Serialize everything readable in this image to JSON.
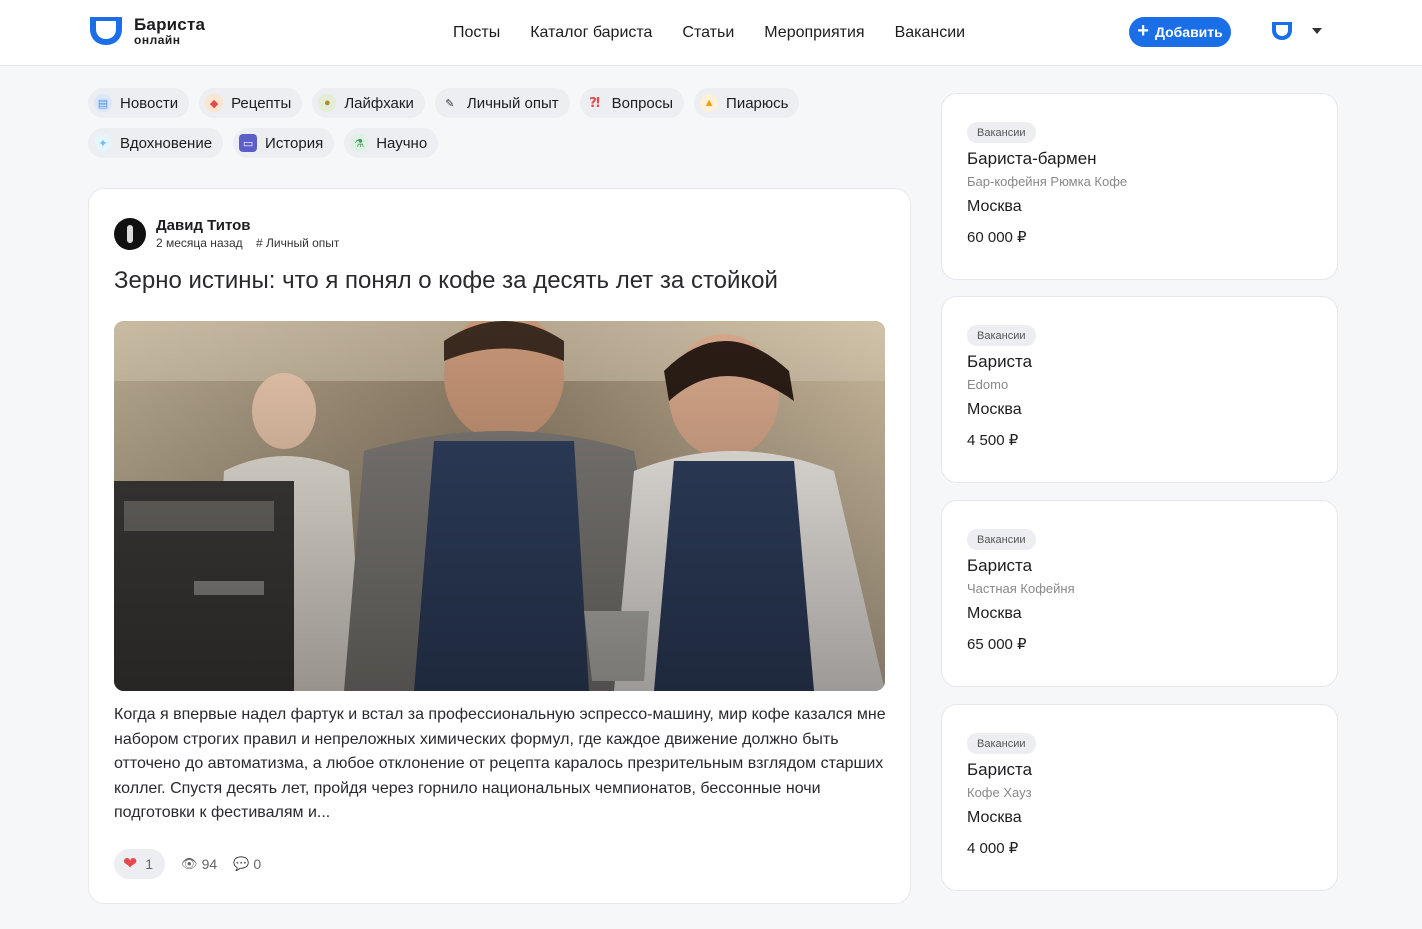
{
  "brand": {
    "title": "Бариста",
    "subtitle": "онлайн",
    "accent": "#1a6fe8"
  },
  "nav": [
    "Посты",
    "Каталог бариста",
    "Статьи",
    "Мероприятия",
    "Вакансии"
  ],
  "add_button": {
    "label": "Добавить",
    "icon": "plus-icon"
  },
  "tags": [
    [
      {
        "label": "Новости",
        "icon": "newspaper-icon",
        "color": "#4a90e2"
      },
      {
        "label": "Рецепты",
        "icon": "bookmark-icon",
        "color": "#f0b35a"
      },
      {
        "label": "Лайфхаки",
        "icon": "flexed-arm-icon",
        "color": "#7aa85a"
      },
      {
        "label": "Личный опыт",
        "icon": "pen-icon",
        "color": "#333333"
      },
      {
        "label": "Вопросы",
        "icon": "interrobang-icon",
        "color": "#e5484d"
      },
      {
        "label": "Пиарюсь",
        "icon": "fire-icon",
        "color": "#f59e0b"
      }
    ],
    [
      {
        "label": "Вдохновение",
        "icon": "sparkles-icon",
        "color": "#6cc0e5"
      },
      {
        "label": "История",
        "icon": "scroll-icon",
        "color": "#5b5fc7"
      },
      {
        "label": "Научно",
        "icon": "microscope-icon",
        "color": "#3a9d5d"
      }
    ]
  ],
  "post": {
    "author": "Давид Титов",
    "time": "2 месяца назад",
    "category": "# Личный опыт",
    "title": "Зерно истины: что я понял о кофе за десять лет за стойкой",
    "text": "Когда я впервые надел фартук и встал за профессиональную эспрессо-машину, мир кофе казался мне набором строгих правил и непреложных химических формул, где каждое движение должно быть отточено до автоматизма, а любое отклонение от рецепта каралось презрительным взглядом старших коллег. Спустя десять лет, пройдя через горнило национальных чемпионатов, бессонные ночи подготовки к фестивалям и...",
    "likes": "1",
    "views": "94",
    "comments": "0"
  },
  "vacancies": [
    {
      "badge": "Вакансии",
      "title": "Бариста-бармен",
      "company": "Бар-кофейня Рюмка Кофе",
      "city": "Москва",
      "salary": "60 000 ₽"
    },
    {
      "badge": "Вакансии",
      "title": "Бариста",
      "company": "Edomo",
      "city": "Москва",
      "salary": "4 500 ₽"
    },
    {
      "badge": "Вакансии",
      "title": "Бариста",
      "company": "Частная Кофейня",
      "city": "Москва",
      "salary": "65 000 ₽"
    },
    {
      "badge": "Вакансии",
      "title": "Бариста",
      "company": "Кофе Хауз",
      "city": "Москва",
      "salary": "4 000 ₽"
    }
  ]
}
